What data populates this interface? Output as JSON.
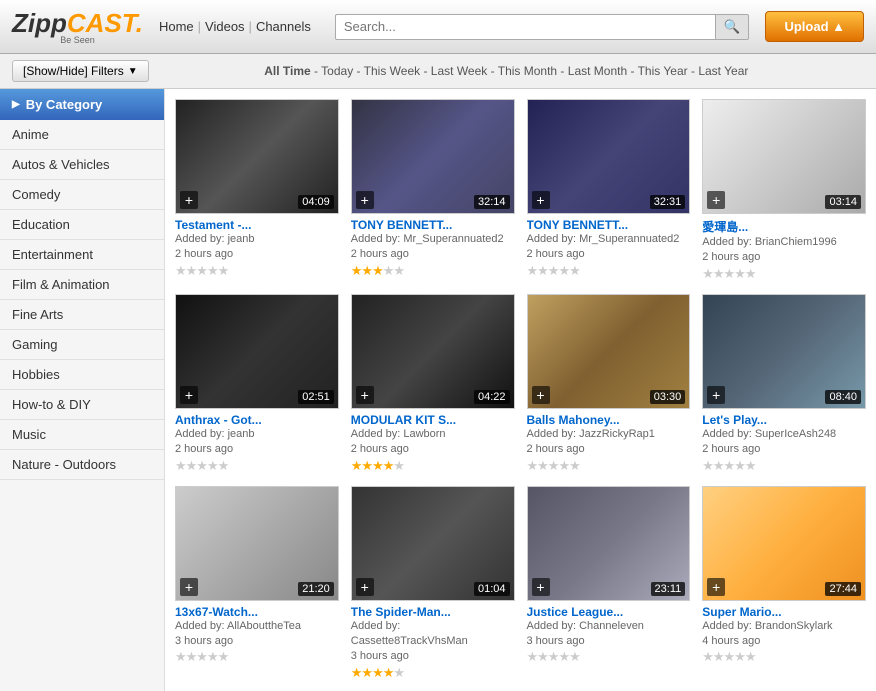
{
  "header": {
    "logo_zipp": "Zipp",
    "logo_cast": "CAST.",
    "logo_sub": "Be Seen",
    "nav": [
      {
        "label": "Home"
      },
      {
        "label": "Videos"
      },
      {
        "label": "Channels"
      }
    ],
    "search_placeholder": "Search...",
    "upload_label": "Upload ▲"
  },
  "filter_bar": {
    "btn_label": "[Show/Hide] Filters",
    "time_options": [
      {
        "label": "All Time",
        "active": true
      },
      {
        "label": "Today"
      },
      {
        "label": "This Week"
      },
      {
        "label": "Last Week"
      },
      {
        "label": "This Month"
      },
      {
        "label": "Last Month"
      },
      {
        "label": "This Year"
      },
      {
        "label": "Last Year"
      }
    ]
  },
  "sidebar": {
    "header_label": "By Category",
    "items": [
      {
        "label": "Anime"
      },
      {
        "label": "Autos & Vehicles"
      },
      {
        "label": "Comedy"
      },
      {
        "label": "Education"
      },
      {
        "label": "Entertainment"
      },
      {
        "label": "Film & Animation"
      },
      {
        "label": "Fine Arts"
      },
      {
        "label": "Gaming"
      },
      {
        "label": "Hobbies"
      },
      {
        "label": "How-to & DIY"
      },
      {
        "label": "Music"
      },
      {
        "label": "Nature - Outdoors"
      }
    ]
  },
  "videos": [
    {
      "title": "Testament -...",
      "added_by": "Added by: jeanb",
      "time_ago": "2 hours ago",
      "duration": "04:09",
      "stars": 0,
      "thumb_class": "thumb-1"
    },
    {
      "title": "TONY BENNETT...",
      "added_by": "Added by: Mr_Superannuated2",
      "time_ago": "2 hours ago",
      "duration": "32:14",
      "stars": 3,
      "thumb_class": "thumb-2"
    },
    {
      "title": "TONY BENNETT...",
      "added_by": "Added by: Mr_Superannuated2",
      "time_ago": "2 hours ago",
      "duration": "32:31",
      "stars": 0,
      "thumb_class": "thumb-3"
    },
    {
      "title": "愛琿島...",
      "added_by": "Added by: BrianChiem1996",
      "time_ago": "2 hours ago",
      "duration": "03:14",
      "stars": 0,
      "thumb_class": "thumb-4"
    },
    {
      "title": "Anthrax - Got...",
      "added_by": "Added by: jeanb",
      "time_ago": "2 hours ago",
      "duration": "02:51",
      "stars": 0,
      "thumb_class": "thumb-5"
    },
    {
      "title": "MODULAR KIT S...",
      "added_by": "Added by: Lawborn",
      "time_ago": "2 hours ago",
      "duration": "04:22",
      "stars": 4,
      "thumb_class": "thumb-6"
    },
    {
      "title": "Balls Mahoney...",
      "added_by": "Added by: JazzRickyRap1",
      "time_ago": "2 hours ago",
      "duration": "03:30",
      "stars": 0,
      "thumb_class": "thumb-7"
    },
    {
      "title": "Let's Play...",
      "added_by": "Added by: SuperIceAsh248",
      "time_ago": "2 hours ago",
      "duration": "08:40",
      "stars": 0,
      "thumb_class": "thumb-8"
    },
    {
      "title": "13x67-Watch...",
      "added_by": "Added by: AllAbouttheTea",
      "time_ago": "3 hours ago",
      "duration": "21:20",
      "stars": 0,
      "thumb_class": "thumb-9"
    },
    {
      "title": "The Spider-Man...",
      "added_by": "Added by: Cassette8TrackVhsMan",
      "time_ago": "3 hours ago",
      "duration": "01:04",
      "stars": 4,
      "thumb_class": "thumb-10"
    },
    {
      "title": "Justice League...",
      "added_by": "Added by: Channeleven",
      "time_ago": "3 hours ago",
      "duration": "23:11",
      "stars": 0,
      "thumb_class": "thumb-11"
    },
    {
      "title": "Super Mario...",
      "added_by": "Added by: BrandonSkylark",
      "time_ago": "4 hours ago",
      "duration": "27:44",
      "stars": 0,
      "thumb_class": "thumb-12"
    }
  ]
}
